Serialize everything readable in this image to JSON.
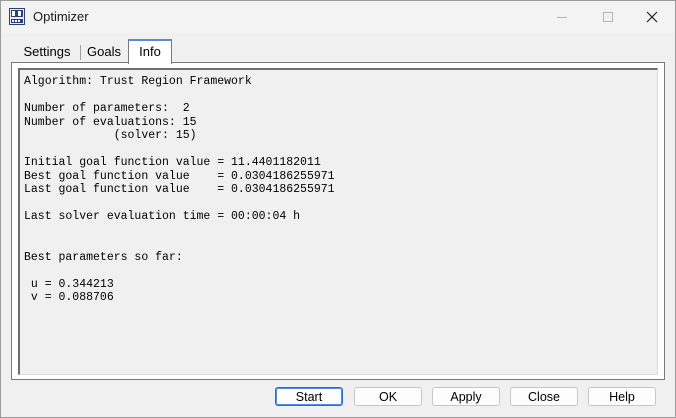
{
  "window": {
    "title": "Optimizer"
  },
  "tabs": [
    {
      "label": "Settings"
    },
    {
      "label": "Goals"
    },
    {
      "label": "Info"
    }
  ],
  "info": {
    "lines": [
      "Algorithm: Trust Region Framework",
      "",
      "Number of parameters:  2",
      "Number of evaluations: 15",
      "             (solver: 15)",
      "",
      "Initial goal function value = 11.4401182011",
      "Best goal function value    = 0.0304186255971",
      "Last goal function value    = 0.0304186255971",
      "",
      "Last solver evaluation time = 00:00:04 h",
      "",
      "",
      "Best parameters so far:",
      "",
      " u = 0.344213",
      " v = 0.088706"
    ]
  },
  "buttons": {
    "start": "Start",
    "ok": "OK",
    "apply": "Apply",
    "close": "Close",
    "help": "Help"
  }
}
